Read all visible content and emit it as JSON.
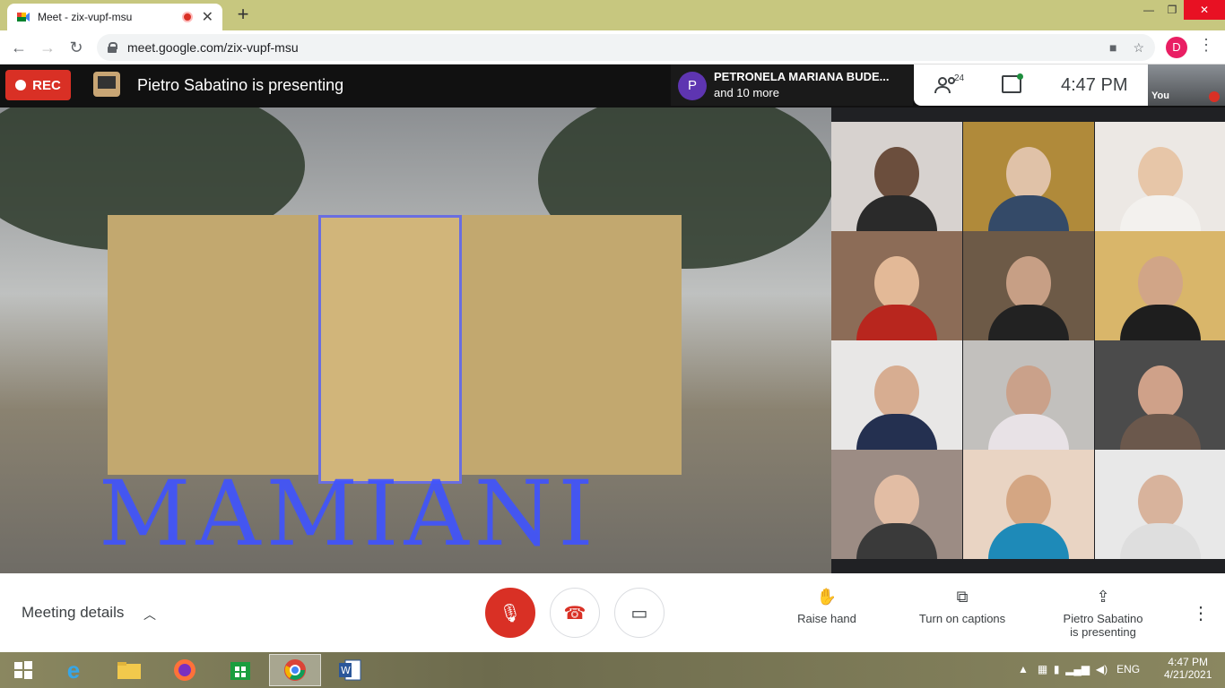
{
  "browser": {
    "tab_title": "Meet - zix-vupf-msu",
    "new_tab": "+",
    "url": "meet.google.com/zix-vupf-msu",
    "profile_initial": "D"
  },
  "meet_header": {
    "rec_label": "REC",
    "presenting_text": "Pietro Sabatino is presenting",
    "speaker_initial": "P",
    "speaker_name": "PETRONELA MARIANA BUDE...",
    "speaker_more": "and 10 more",
    "people_count": "24",
    "time": "4:47  PM",
    "self_label": "You"
  },
  "presentation": {
    "sign_text": "MAMIANI"
  },
  "controls": {
    "meeting_details": "Meeting details",
    "raise_hand": "Raise hand",
    "captions": "Turn on captions",
    "presenting_line1": "Pietro Sabatino",
    "presenting_line2": "is presenting"
  },
  "taskbar": {
    "language": "ENG",
    "time": "4:47 PM",
    "date": "4/21/2021"
  },
  "colors": {
    "accent_red": "#d93025",
    "chip_avatar": "#5e35b1",
    "profile": "#e91e63"
  }
}
